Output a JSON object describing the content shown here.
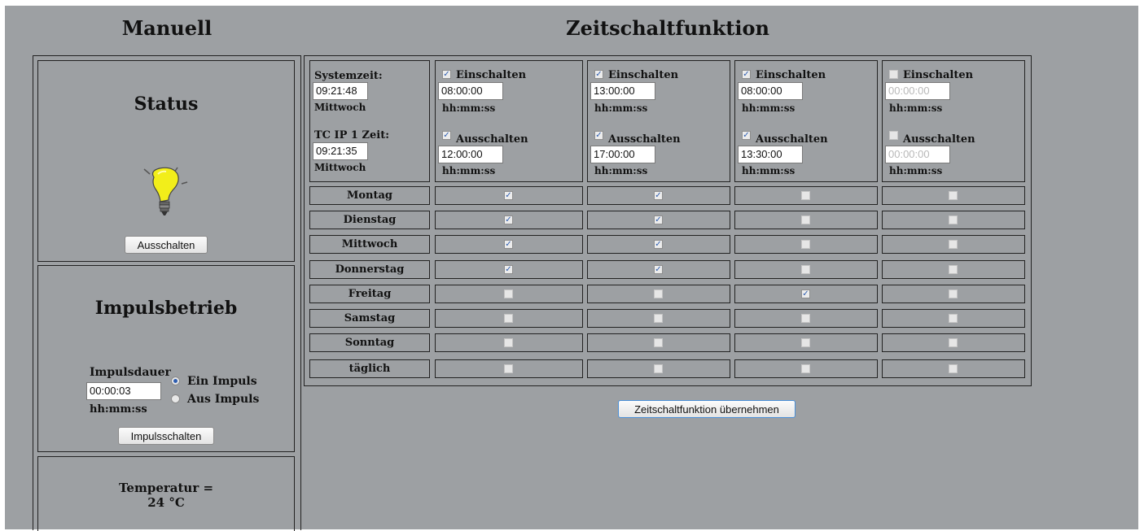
{
  "left": {
    "title": "Manuell",
    "status": {
      "title": "Status",
      "button": "Ausschalten"
    },
    "impuls": {
      "title": "Impulsbetrieb",
      "duration_label": "Impulsdauer",
      "duration_value": "00:00:03",
      "format": "hh:mm:ss",
      "radio_on": "Ein Impuls",
      "radio_off": "Aus Impuls",
      "button": "Impulsschalten"
    },
    "temperature": {
      "label": "Temperatur =",
      "value": "24 °C"
    }
  },
  "right": {
    "title": "Zeitschaltfunktion",
    "system": {
      "systemzeit_label": "Systemzeit:",
      "systemzeit_value": "09:21:48",
      "systemzeit_day": "Mittwoch",
      "tc_label": "TC IP 1 Zeit:",
      "tc_value": "09:21:35",
      "tc_day": "Mittwoch"
    },
    "on_label": "Einschalten",
    "off_label": "Ausschalten",
    "format": "hh:mm:ss",
    "timers": [
      {
        "on_checked": true,
        "on_time": "08:00:00",
        "off_checked": true,
        "off_time": "12:00:00"
      },
      {
        "on_checked": true,
        "on_time": "13:00:00",
        "off_checked": true,
        "off_time": "17:00:00"
      },
      {
        "on_checked": true,
        "on_time": "08:00:00",
        "off_checked": true,
        "off_time": "13:30:00"
      },
      {
        "on_checked": false,
        "on_time": "00:00:00",
        "off_checked": false,
        "off_time": "00:00:00"
      }
    ],
    "days": [
      {
        "name": "Montag",
        "checks": [
          true,
          true,
          false,
          false
        ]
      },
      {
        "name": "Dienstag",
        "checks": [
          true,
          true,
          false,
          false
        ]
      },
      {
        "name": "Mittwoch",
        "checks": [
          true,
          true,
          false,
          false
        ]
      },
      {
        "name": "Donnerstag",
        "checks": [
          true,
          true,
          false,
          false
        ]
      },
      {
        "name": "Freitag",
        "checks": [
          false,
          false,
          true,
          false
        ]
      },
      {
        "name": "Samstag",
        "checks": [
          false,
          false,
          false,
          false
        ]
      },
      {
        "name": "Sonntag",
        "checks": [
          false,
          false,
          false,
          false
        ]
      },
      {
        "name": "täglich",
        "checks": [
          false,
          false,
          false,
          false
        ]
      }
    ],
    "apply_button": "Zeitschaltfunktion übernehmen"
  }
}
